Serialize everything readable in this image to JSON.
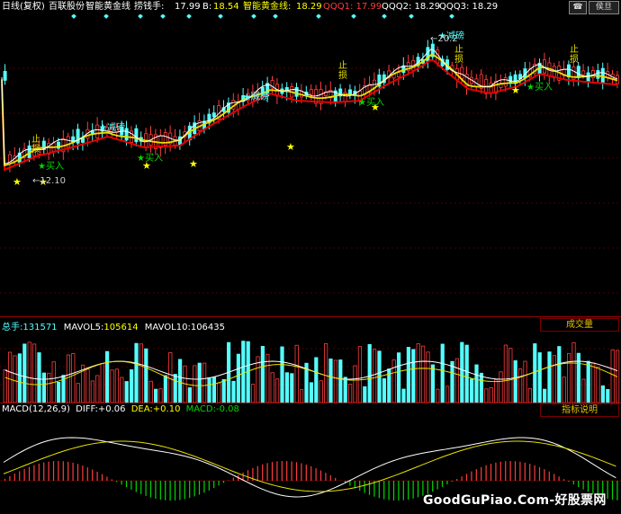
{
  "header": {
    "mode": "日线(复权)",
    "stock": "百联股份",
    "indicator": "智能黄金线",
    "lao": {
      "label": "捞钱手:",
      "value": "17.99"
    },
    "b": {
      "label": "B:",
      "value": "18.54"
    },
    "gold": {
      "label": "智能黄金线:",
      "value": "18.29"
    },
    "qqq1": "QQQ1: 17.99",
    "qqq2": "QQQ2: 18.29",
    "qqq3": "QQQ3: 18.29",
    "btn_a": "☎",
    "btn_b": "侯旦"
  },
  "colors": {
    "up": "#ff3c3c",
    "down": "#54ffff",
    "gold": "#e8e200",
    "redline": "#e60000",
    "white": "#ffffff",
    "green": "#00d800"
  },
  "annotations": {
    "buy": "★买入",
    "reduce": "★减磅",
    "stop_top": "止",
    "stop_bot": "损",
    "low_price": "←12.10",
    "high_price": "←20.2"
  },
  "volume": {
    "total": {
      "label": "总手:",
      "value": "131571"
    },
    "mavol5": {
      "label": "MAVOL5:",
      "value": "105614"
    },
    "mavol10": {
      "label": "MAVOL10:",
      "value": "106435"
    },
    "button": "成交量"
  },
  "macd": {
    "title": "MACD(12,26,9)",
    "diff": {
      "label": "DIFF:",
      "value": "+0.06"
    },
    "dea": {
      "label": "DEA:",
      "value": "+0.10"
    },
    "macd": {
      "label": "MACD:",
      "value": "-0.08"
    },
    "button": "指标说明"
  },
  "watermark": "GoodGuPiao.Com-好股票网"
}
